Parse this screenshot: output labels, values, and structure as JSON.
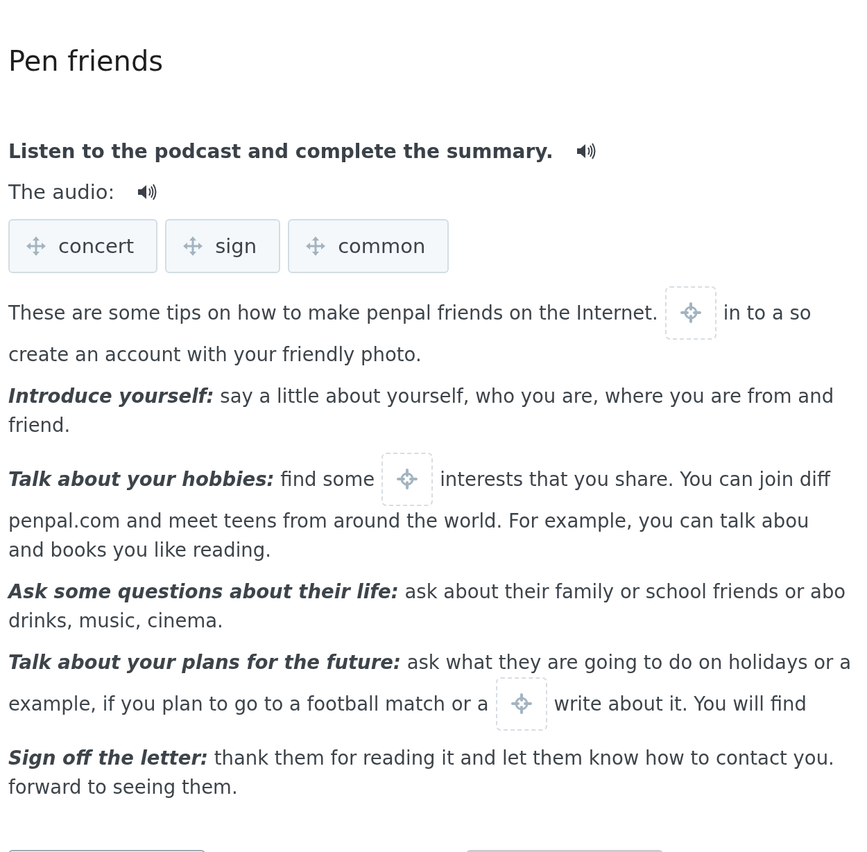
{
  "title": "Pen friends",
  "instruction": {
    "text": "Listen to the podcast and complete the summary."
  },
  "audio": {
    "label": "The audio:"
  },
  "word_bank": [
    {
      "text": "concert"
    },
    {
      "text": "sign"
    },
    {
      "text": "common"
    }
  ],
  "paragraphs": [
    {
      "lines": [
        [
          {
            "kind": "text",
            "text": "These are some tips on how to make penpal friends on the Internet."
          },
          {
            "kind": "gap"
          },
          {
            "kind": "text",
            "text": "in to a so"
          }
        ],
        [
          {
            "kind": "text",
            "text": "create an account with your friendly photo."
          }
        ]
      ]
    },
    {
      "lines": [
        [
          {
            "kind": "text",
            "text": "**Introduce yourself:** say a little about yourself, who you are, where you are from and"
          }
        ],
        [
          {
            "kind": "text",
            "text": "friend."
          }
        ]
      ]
    },
    {
      "lines": [
        [
          {
            "kind": "text",
            "text": "**Talk about your hobbies:** find some"
          },
          {
            "kind": "gap"
          },
          {
            "kind": "text",
            "text": "interests that you share. You can join diff"
          }
        ],
        [
          {
            "kind": "text",
            "text": "penpal.com and meet teens from around the world. For example, you can talk abou"
          }
        ],
        [
          {
            "kind": "text",
            "text": "and books you like reading."
          }
        ]
      ]
    },
    {
      "lines": [
        [
          {
            "kind": "text",
            "text": "**Ask some questions about their life:** ask about their family or school friends or abo"
          }
        ],
        [
          {
            "kind": "text",
            "text": "drinks, music, cinema."
          }
        ]
      ]
    },
    {
      "lines": [
        [
          {
            "kind": "text",
            "text": "**Talk about your plans for the future:** ask what they are going to do on holidays or a"
          }
        ],
        [
          {
            "kind": "text",
            "text": "example, if you plan to go to a football match or a"
          },
          {
            "kind": "gap"
          },
          {
            "kind": "text",
            "text": "write about it. You will find"
          }
        ]
      ]
    },
    {
      "lines": [
        [
          {
            "kind": "text",
            "text": "**Sign off the letter:** thank them for reading it and let them know how to contact you."
          }
        ],
        [
          {
            "kind": "text",
            "text": "forward to seeing them."
          }
        ]
      ]
    }
  ],
  "buttons": [
    {
      "kind": "outline"
    },
    {
      "kind": "filled"
    }
  ]
}
